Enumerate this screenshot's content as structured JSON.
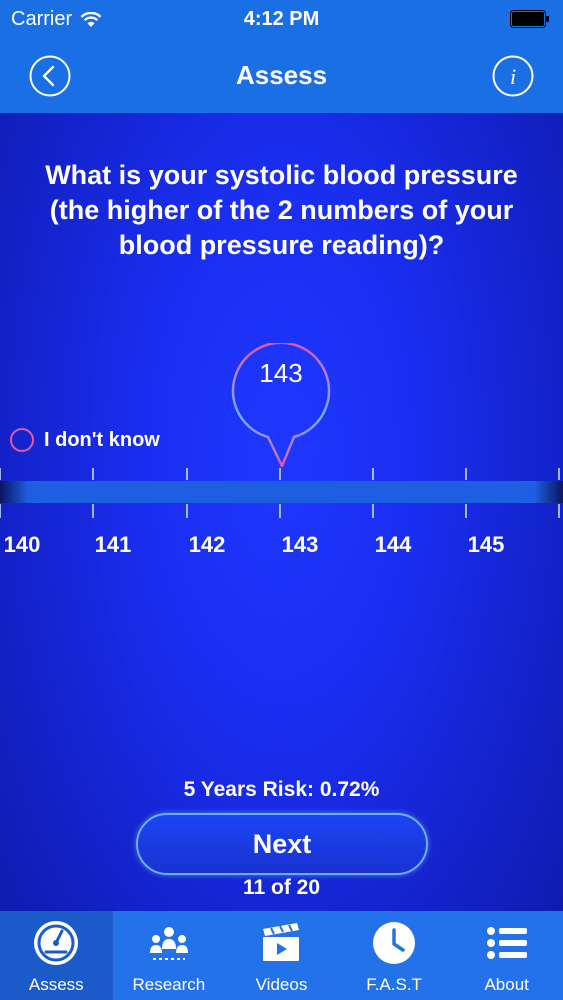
{
  "status_bar": {
    "carrier": "Carrier",
    "time": "4:12 PM"
  },
  "nav": {
    "title": "Assess"
  },
  "question": "What is your systolic blood pressure (the higher of the 2 numbers of your blood pressure reading)?",
  "selector": {
    "selected_value": "143",
    "dont_know_label": "I don't know",
    "ticks": [
      "140",
      "141",
      "142",
      "143",
      "144",
      "145"
    ]
  },
  "risk_text": "5 Years Risk: 0.72%",
  "next_button": "Next",
  "progress_text": "11 of 20",
  "tabs": [
    {
      "label": "Assess",
      "icon": "gauge-icon"
    },
    {
      "label": "Research",
      "icon": "research-icon"
    },
    {
      "label": "Videos",
      "icon": "clapperboard-icon"
    },
    {
      "label": "F.A.S.T",
      "icon": "clock-icon"
    },
    {
      "label": "About",
      "icon": "list-icon"
    }
  ],
  "colors": {
    "accent_pink": "#e25aa7",
    "accent_blue": "#6ab0ff",
    "topbar": "#1a6fe4",
    "background": "#1a2ef0"
  }
}
